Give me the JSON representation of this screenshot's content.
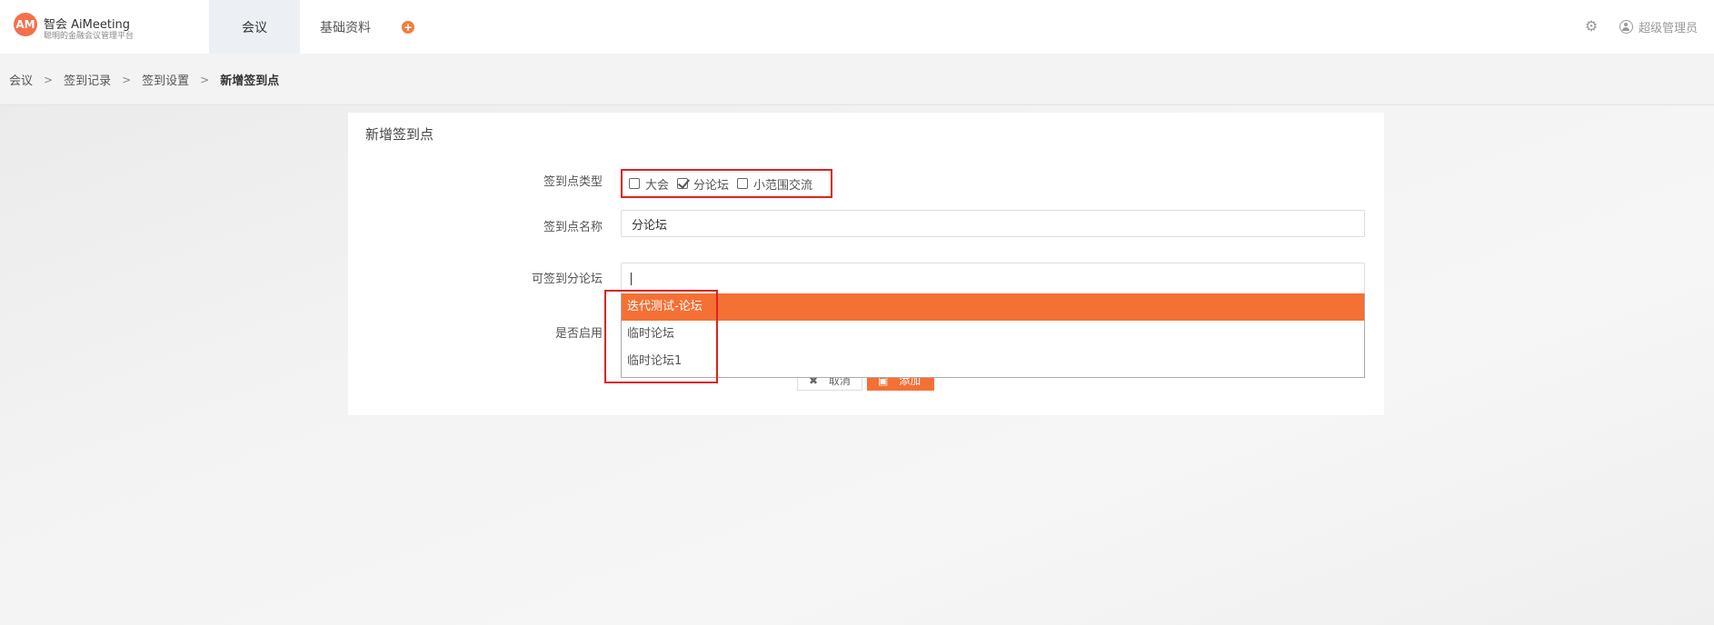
{
  "header": {
    "logo_text": "AM",
    "brand_title": "智会 AiMeeting",
    "brand_subtitle": "聪明的金融会议管理平台",
    "tabs": [
      {
        "label": "会议",
        "active": true
      },
      {
        "label": "基础资料",
        "active": false
      }
    ],
    "add_icon": "plus-circle-icon",
    "settings_icon": "gear-icon",
    "user_icon": "user-circle-icon",
    "user_name": "超级管理员",
    "accent_color": "#f57034"
  },
  "breadcrumb": [
    "会议",
    "签到记录",
    "签到设置",
    "新增签到点"
  ],
  "form": {
    "title": "新增签到点",
    "type_label": "签到点类型",
    "type_options": [
      {
        "label": "大会",
        "checked": false
      },
      {
        "label": "分论坛",
        "checked": true
      },
      {
        "label": "小范围交流",
        "checked": false
      }
    ],
    "name_label": "签到点名称",
    "name_value": "分论坛",
    "forum_label": "可签到分论坛",
    "forum_value": "",
    "dropdown_options": [
      {
        "label": "迭代测试-论坛",
        "highlighted": true
      },
      {
        "label": "临时论坛",
        "highlighted": false
      },
      {
        "label": "临时论坛1",
        "highlighted": false
      }
    ],
    "enabled_label": "是否启用",
    "cancel_label": "取消",
    "add_label": "添加"
  }
}
